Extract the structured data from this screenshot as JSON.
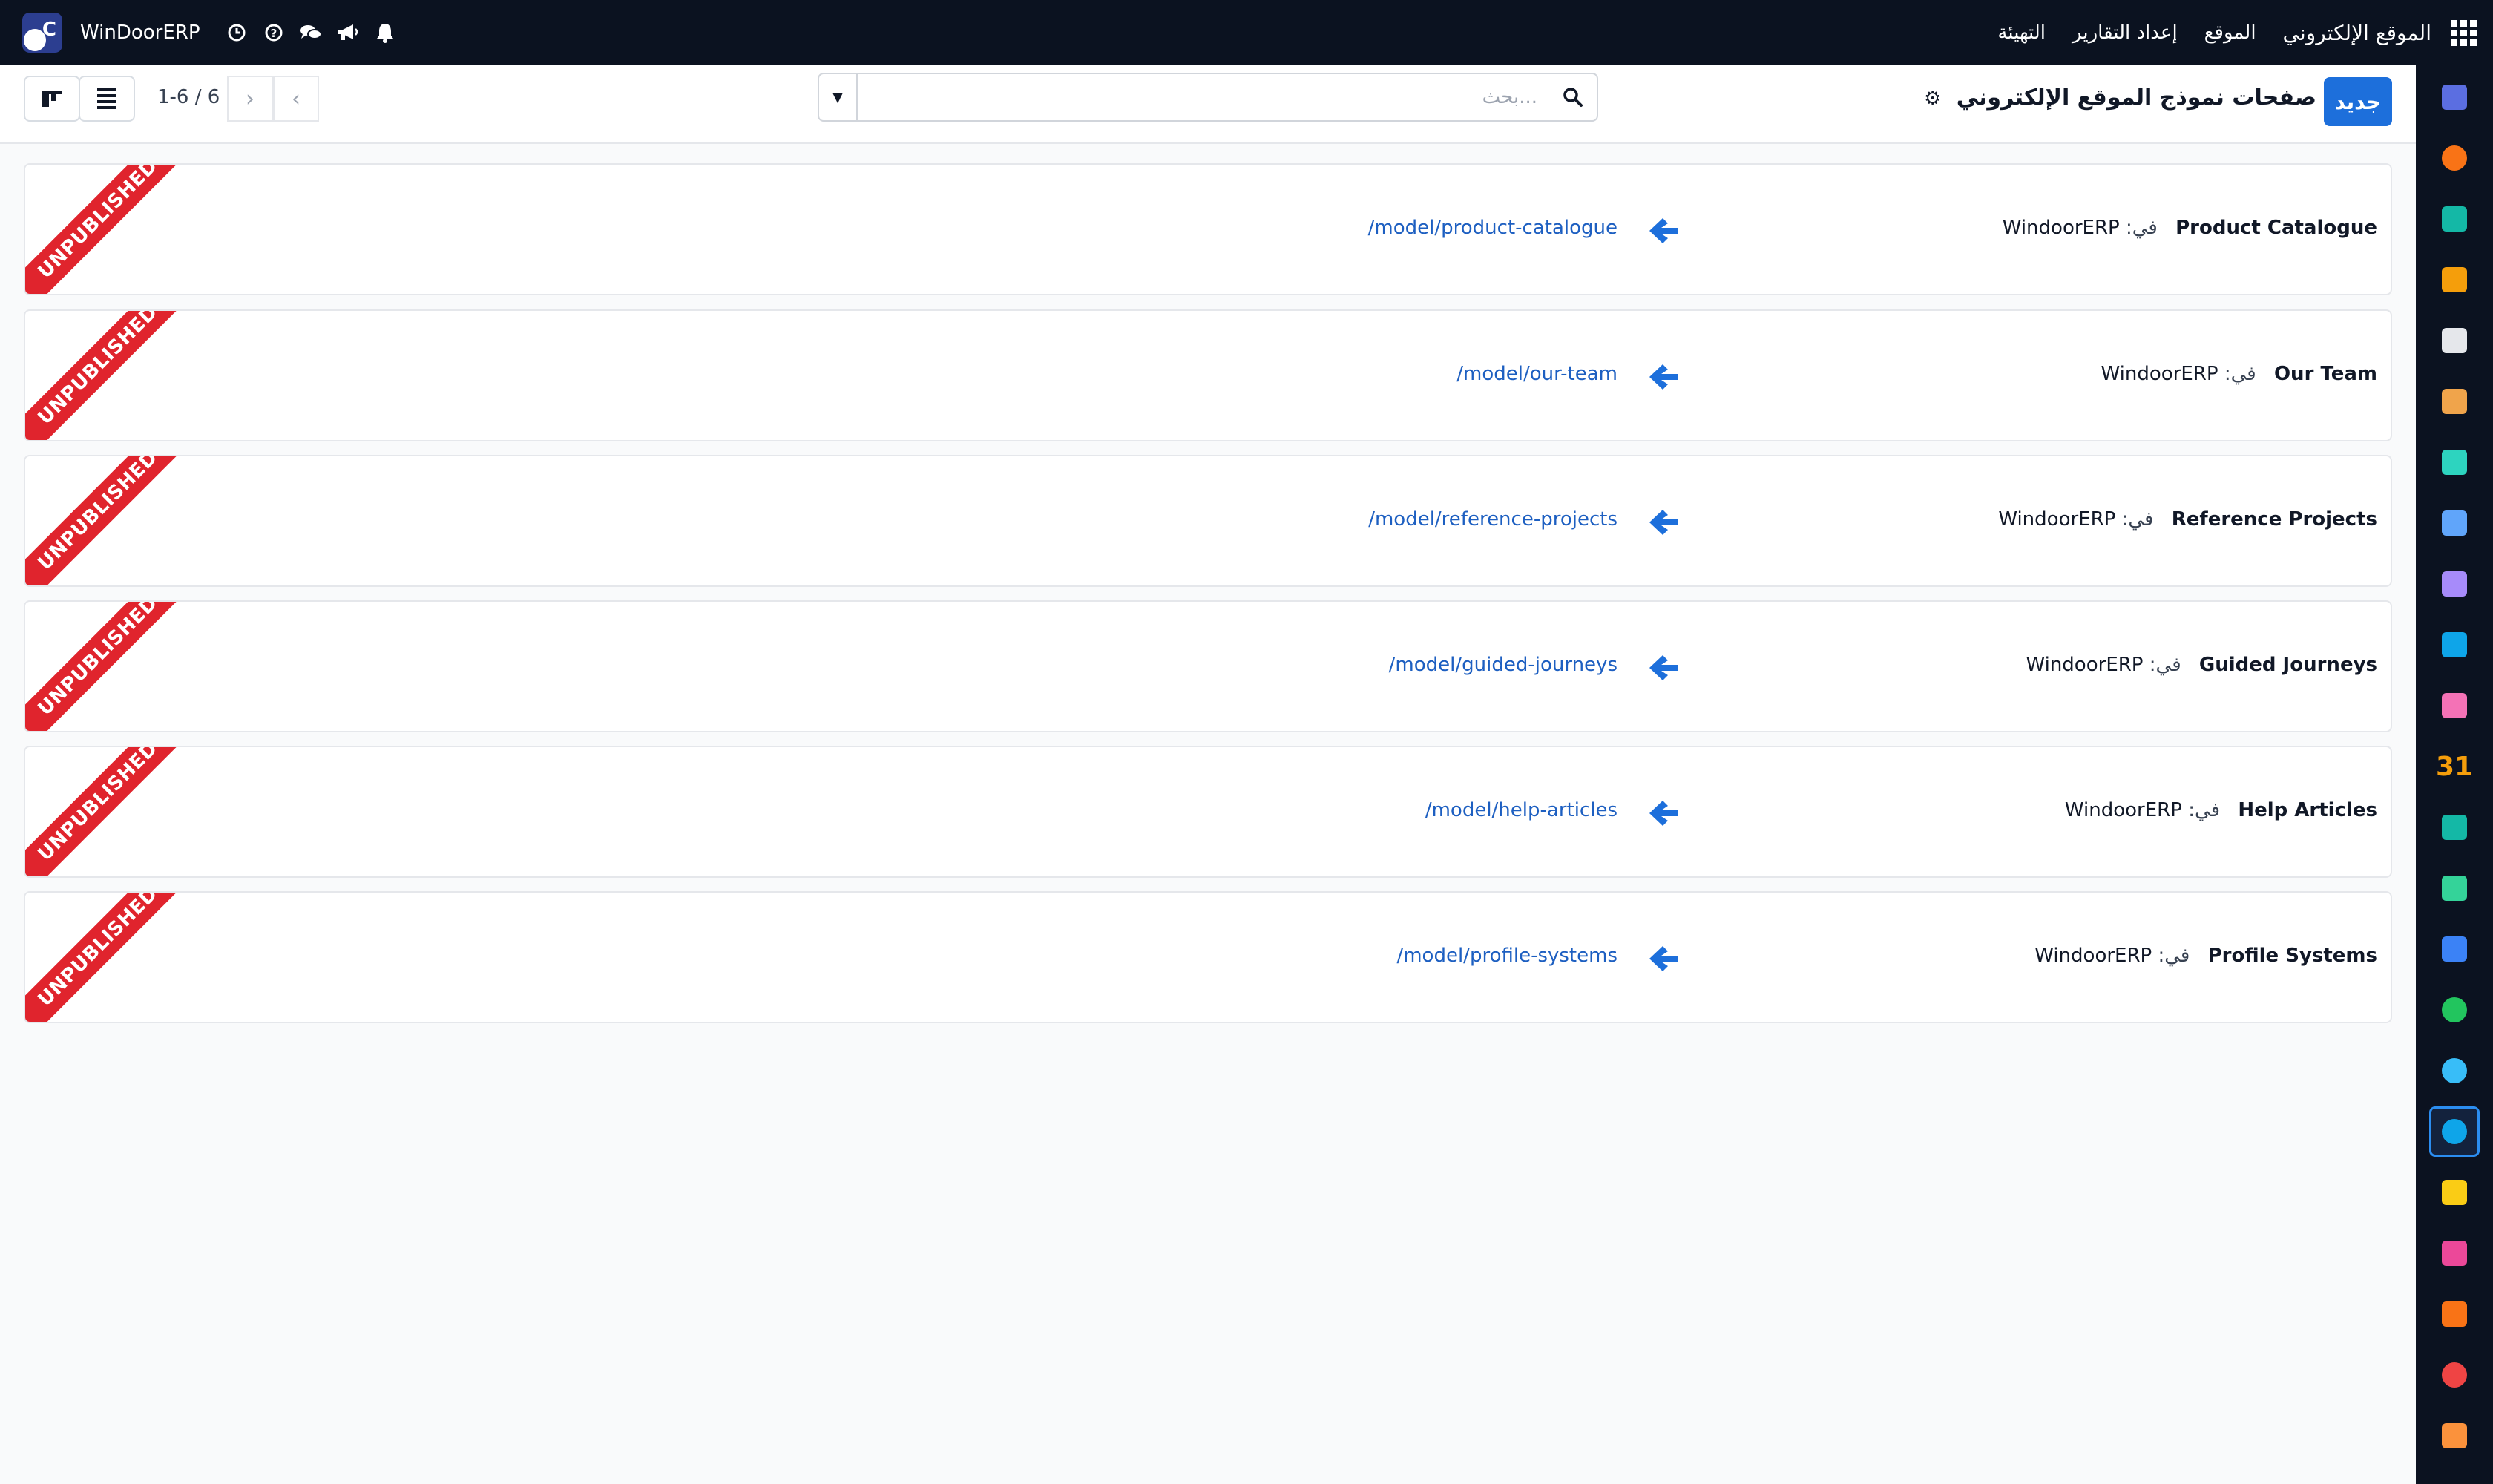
{
  "topbar": {
    "company": "WinDoorERP",
    "app_name": "الموقع الإلكتروني",
    "menus": [
      "الموقع",
      "إعداد التقارير",
      "التهيئة"
    ],
    "icons": [
      "clock-icon",
      "help-icon",
      "chat-icon",
      "megaphone-icon",
      "bell-icon"
    ]
  },
  "control": {
    "new_label": "جديد",
    "title": "صفحات نموذج الموقع الإلكتروني",
    "search_placeholder": "بحث...",
    "pager": "1-6 / 6"
  },
  "rows": [
    {
      "name": "Product Catalogue",
      "in_label": "في:",
      "website": "WindoorERP",
      "url": "/model/product-catalogue",
      "status": "UNPUBLISHED"
    },
    {
      "name": "Our Team",
      "in_label": "في:",
      "website": "WindoorERP",
      "url": "/model/our-team",
      "status": "UNPUBLISHED"
    },
    {
      "name": "Reference Projects",
      "in_label": "في:",
      "website": "WindoorERP",
      "url": "/model/reference-projects",
      "status": "UNPUBLISHED"
    },
    {
      "name": "Guided Journeys",
      "in_label": "في:",
      "website": "WindoorERP",
      "url": "/model/guided-journeys",
      "status": "UNPUBLISHED"
    },
    {
      "name": "Help Articles",
      "in_label": "في:",
      "website": "WindoorERP",
      "url": "/model/help-articles",
      "status": "UNPUBLISHED"
    },
    {
      "name": "Profile Systems",
      "in_label": "في:",
      "website": "WindoorERP",
      "url": "/model/profile-systems",
      "status": "UNPUBLISHED"
    }
  ],
  "sidebar": {
    "apps": [
      {
        "icon": "mail-marketing-icon",
        "color": "#5b6ee1"
      },
      {
        "icon": "live-chat-icon",
        "color": "#f97316"
      },
      {
        "icon": "discuss-icon",
        "color": "#14b8a6"
      },
      {
        "icon": "reporting-icon",
        "color": "#f59e0b"
      },
      {
        "icon": "inventory-box-icon",
        "color": "#e5e7eb"
      },
      {
        "icon": "sales-icon",
        "color": "#f0a44b"
      },
      {
        "icon": "tasks-check-icon",
        "color": "#2dd4bf"
      },
      {
        "icon": "knowledge-icon",
        "color": "#60a5fa"
      },
      {
        "icon": "products-icon",
        "color": "#a78bfa"
      },
      {
        "icon": "invoicing-icon",
        "color": "#0ea5e9"
      },
      {
        "icon": "employees-icon",
        "color": "#f472b6"
      },
      {
        "icon": "calendar-icon",
        "color": "#f59e0b",
        "text": "31"
      },
      {
        "icon": "sign-icon",
        "color": "#14b8a6"
      },
      {
        "icon": "contacts-icon",
        "color": "#34d399"
      },
      {
        "icon": "dashboards-icon",
        "color": "#3b82f6"
      },
      {
        "icon": "whatsapp-icon",
        "color": "#22c55e"
      },
      {
        "icon": "timer-icon",
        "color": "#38bdf8"
      },
      {
        "icon": "website-icon",
        "color": "#0ea5e9"
      },
      {
        "icon": "send-icon",
        "color": "#facc15"
      },
      {
        "icon": "payment-card-icon",
        "color": "#ec4899"
      },
      {
        "icon": "purchase-icon",
        "color": "#f97316"
      },
      {
        "icon": "pie-chart-icon",
        "color": "#ef4444"
      },
      {
        "icon": "hexagon-icon",
        "color": "#fb923c"
      }
    ],
    "active_index": 17
  }
}
